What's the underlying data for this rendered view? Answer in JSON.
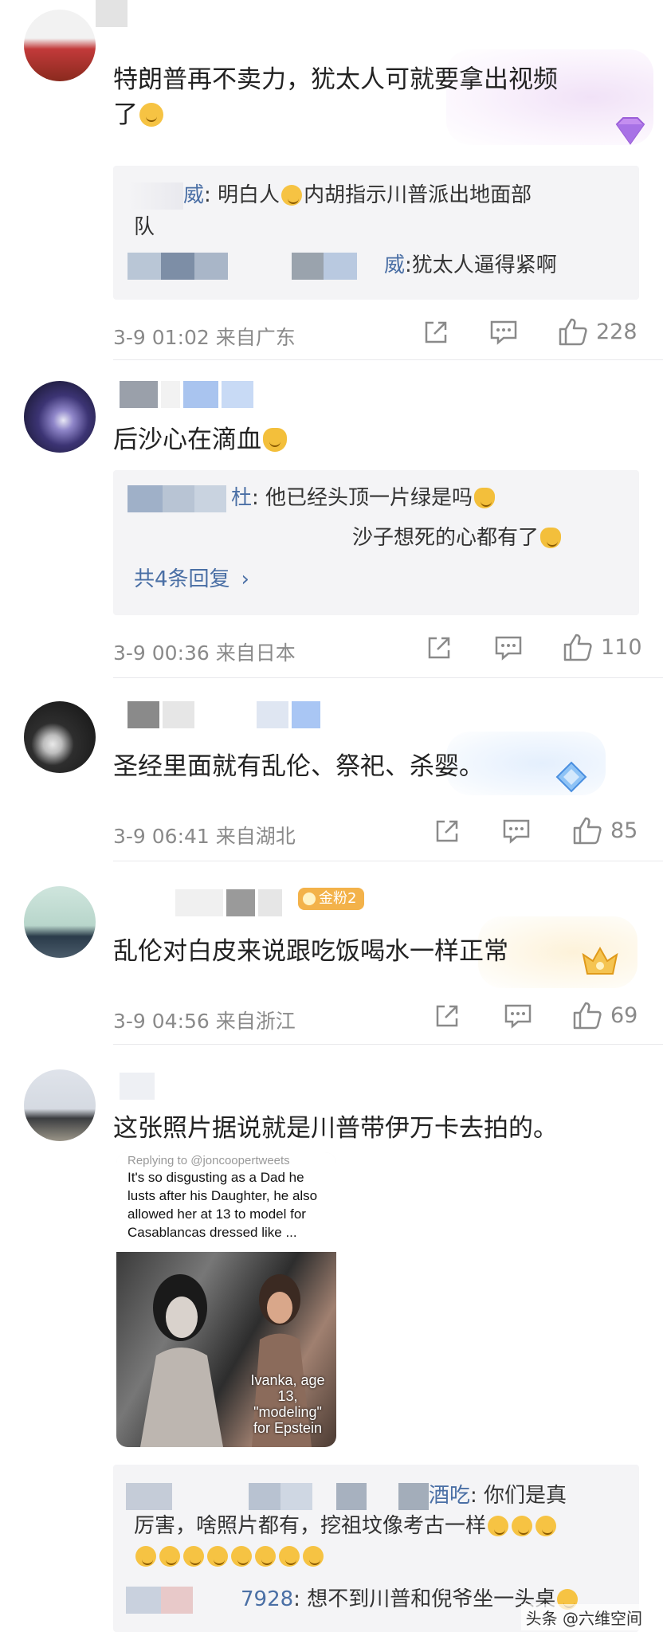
{
  "comments": [
    {
      "text_line1": "特朗普再不卖力，犹太人可就要拿出视频",
      "text_line2": "了",
      "replies": [
        {
          "name_tail": "威",
          "text": "明白人",
          "text_after": "内胡指示川普派出地面部",
          "text_cont": "队"
        },
        {
          "name_tail": "威",
          "text": "犹太人逼得紧啊"
        }
      ],
      "meta": "3-9 01:02  来自广东",
      "likes": "228"
    },
    {
      "text": "后沙心在滴血",
      "replies": [
        {
          "name_tail": "杜",
          "text": "他已经头顶一片绿是吗"
        },
        {
          "text": "沙子想死的心都有了"
        }
      ],
      "more_replies": "共4条回复",
      "meta": "3-9 00:36  来自日本",
      "likes": "110"
    },
    {
      "text": "圣经里面就有乱伦、祭祀、杀婴。",
      "meta": "3-9 06:41  来自湖北",
      "likes": "85"
    },
    {
      "badge": "金粉2",
      "text": "乱伦对白皮来说跟吃饭喝水一样正常",
      "meta": "3-9 04:56  来自浙江",
      "likes": "69"
    },
    {
      "text": "这张照片据说就是川普带伊万卡去拍的。",
      "photo": {
        "replying": "Replying to @joncoopertweets",
        "caption_text": "It's so disgusting as a Dad he lusts after his Daughter, he also allowed her at 13 to model for Casablancas dressed like ...",
        "overlay": "Ivanka, age 13, \"modeling\" for Epstein"
      },
      "replies": [
        {
          "name_tail": "酒吃",
          "text": "你们是真",
          "text_cont": "厉害，啥照片都有，挖祖坟像考古一样"
        },
        {
          "name_tail": "7928",
          "text": "想不到川普和倪爷坐一头桌"
        }
      ]
    }
  ],
  "watermark": "头条 @六维空间",
  "colors": {
    "accent_blue": "#4a6fa5",
    "meta_gray": "#8a8a8a",
    "reply_bg": "#f4f4f6"
  }
}
